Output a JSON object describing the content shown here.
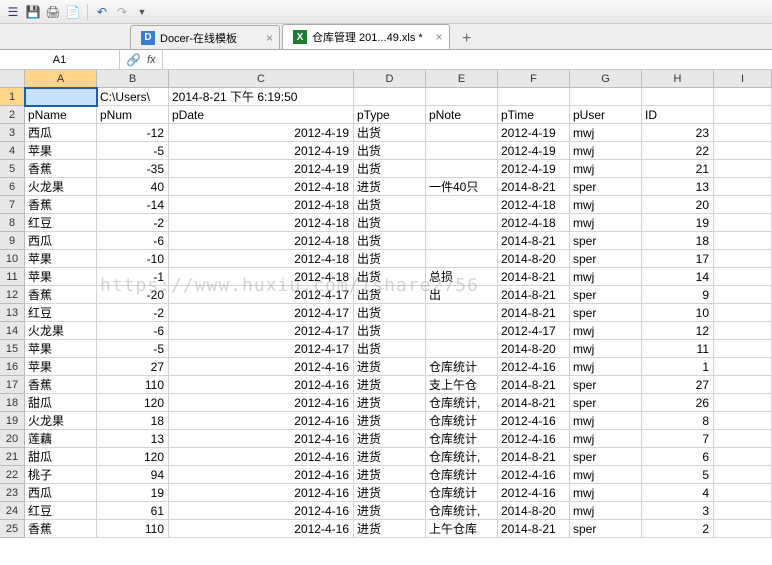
{
  "toolbar": {
    "title": "工具栏"
  },
  "tabs": [
    {
      "label": "Docer-在线模板",
      "icon_bg": "#3a7bd5",
      "icon_text": "D",
      "active": false
    },
    {
      "label": "仓库管理 201...49.xls *",
      "icon_bg": "#1e7e34",
      "icon_text": "X",
      "active": true
    }
  ],
  "name_box": "A1",
  "col_headers": [
    "A",
    "B",
    "C",
    "D",
    "E",
    "F",
    "G",
    "H",
    "I"
  ],
  "selected_cell": "A1",
  "chart_data": {
    "type": "table",
    "title": "仓库管理",
    "path_line": "C:\\Users\\",
    "timestamp": "2014-8-21 下午 6:19:50",
    "columns": [
      "pName",
      "pNum",
      "pDate",
      "pType",
      "pNote",
      "pTime",
      "pUser",
      "ID"
    ],
    "rows": [
      {
        "pName": "西瓜",
        "pNum": -12,
        "pDate": "2012-4-19",
        "pType": "出货",
        "pNote": "",
        "pTime": "2012-4-19",
        "pUser": "mwj",
        "ID": 23
      },
      {
        "pName": "苹果",
        "pNum": -5,
        "pDate": "2012-4-19",
        "pType": "出货",
        "pNote": "",
        "pTime": "2012-4-19",
        "pUser": "mwj",
        "ID": 22
      },
      {
        "pName": "香蕉",
        "pNum": -35,
        "pDate": "2012-4-19",
        "pType": "出货",
        "pNote": "",
        "pTime": "2012-4-19",
        "pUser": "mwj",
        "ID": 21
      },
      {
        "pName": "火龙果",
        "pNum": 40,
        "pDate": "2012-4-18",
        "pType": "进货",
        "pNote": "一件40只",
        "pTime": "2014-8-21",
        "pUser": "sper",
        "ID": 13
      },
      {
        "pName": "香蕉",
        "pNum": -14,
        "pDate": "2012-4-18",
        "pType": "出货",
        "pNote": "",
        "pTime": "2012-4-18",
        "pUser": "mwj",
        "ID": 20
      },
      {
        "pName": "红豆",
        "pNum": -2,
        "pDate": "2012-4-18",
        "pType": "出货",
        "pNote": "",
        "pTime": "2012-4-18",
        "pUser": "mwj",
        "ID": 19
      },
      {
        "pName": "西瓜",
        "pNum": -6,
        "pDate": "2012-4-18",
        "pType": "出货",
        "pNote": "",
        "pTime": "2014-8-21",
        "pUser": "sper",
        "ID": 18
      },
      {
        "pName": "苹果",
        "pNum": -10,
        "pDate": "2012-4-18",
        "pType": "出货",
        "pNote": "",
        "pTime": "2014-8-20",
        "pUser": "sper",
        "ID": 17
      },
      {
        "pName": "苹果",
        "pNum": -1,
        "pDate": "2012-4-18",
        "pType": "出货",
        "pNote": "总损",
        "pTime": "2014-8-21",
        "pUser": "mwj",
        "ID": 14
      },
      {
        "pName": "香蕉",
        "pNum": -20,
        "pDate": "2012-4-17",
        "pType": "出货",
        "pNote": "出",
        "pTime": "2014-8-21",
        "pUser": "sper",
        "ID": 9
      },
      {
        "pName": "红豆",
        "pNum": -2,
        "pDate": "2012-4-17",
        "pType": "出货",
        "pNote": "",
        "pTime": "2014-8-21",
        "pUser": "sper",
        "ID": 10
      },
      {
        "pName": "火龙果",
        "pNum": -6,
        "pDate": "2012-4-17",
        "pType": "出货",
        "pNote": "",
        "pTime": "2012-4-17",
        "pUser": "mwj",
        "ID": 12
      },
      {
        "pName": "苹果",
        "pNum": -5,
        "pDate": "2012-4-17",
        "pType": "出货",
        "pNote": "",
        "pTime": "2014-8-20",
        "pUser": "mwj",
        "ID": 11
      },
      {
        "pName": "苹果",
        "pNum": 27,
        "pDate": "2012-4-16",
        "pType": "进货",
        "pNote": "仓库统计",
        "pTime": "2012-4-16",
        "pUser": "mwj",
        "ID": 1
      },
      {
        "pName": "香蕉",
        "pNum": 110,
        "pDate": "2012-4-16",
        "pType": "进货",
        "pNote": "支上午仓",
        "pTime": "2014-8-21",
        "pUser": "sper",
        "ID": 27
      },
      {
        "pName": "甜瓜",
        "pNum": 120,
        "pDate": "2012-4-16",
        "pType": "进货",
        "pNote": "仓库统计,",
        "pTime": "2014-8-21",
        "pUser": "sper",
        "ID": 26
      },
      {
        "pName": "火龙果",
        "pNum": 18,
        "pDate": "2012-4-16",
        "pType": "进货",
        "pNote": "仓库统计",
        "pTime": "2012-4-16",
        "pUser": "mwj",
        "ID": 8
      },
      {
        "pName": "莲藕",
        "pNum": 13,
        "pDate": "2012-4-16",
        "pType": "进货",
        "pNote": "仓库统计",
        "pTime": "2012-4-16",
        "pUser": "mwj",
        "ID": 7
      },
      {
        "pName": "甜瓜",
        "pNum": 120,
        "pDate": "2012-4-16",
        "pType": "进货",
        "pNote": "仓库统计,",
        "pTime": "2014-8-21",
        "pUser": "sper",
        "ID": 6
      },
      {
        "pName": "桃子",
        "pNum": 94,
        "pDate": "2012-4-16",
        "pType": "进货",
        "pNote": "仓库统计",
        "pTime": "2012-4-16",
        "pUser": "mwj",
        "ID": 5
      },
      {
        "pName": "西瓜",
        "pNum": 19,
        "pDate": "2012-4-16",
        "pType": "进货",
        "pNote": "仓库统计",
        "pTime": "2012-4-16",
        "pUser": "mwj",
        "ID": 4
      },
      {
        "pName": "红豆",
        "pNum": 61,
        "pDate": "2012-4-16",
        "pType": "进货",
        "pNote": "仓库统计,",
        "pTime": "2014-8-20",
        "pUser": "mwj",
        "ID": 3
      },
      {
        "pName": "香蕉",
        "pNum": 110,
        "pDate": "2012-4-16",
        "pType": "进货",
        "pNote": "上午仓库",
        "pTime": "2014-8-21",
        "pUser": "sper",
        "ID": 2
      }
    ]
  },
  "watermark": "https://www.huxiu.com/ishare2756"
}
